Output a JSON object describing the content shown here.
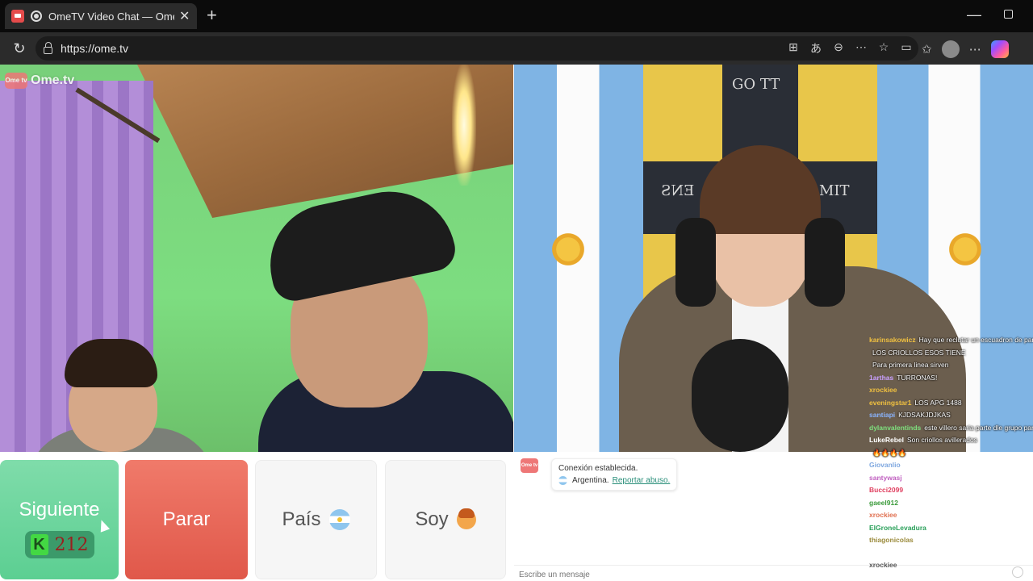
{
  "browser": {
    "tab_title": "OmeTV Video Chat — Omegle",
    "tab_close": "✕",
    "new_tab": "+",
    "url": "https://ome.tv"
  },
  "left_video": {
    "watermark": "Ome.tv",
    "badge": "Ome tv"
  },
  "right_video": {
    "banner_top": "GO TT",
    "banner_left": "ENS",
    "banner_right": "MIT"
  },
  "stream_chat": [
    {
      "user": "karinsakowicz",
      "color": "#f0c040",
      "msg": "Hay que reclutar un escuadron de par"
    },
    {
      "user": "",
      "color": "#8ab4ff",
      "msg": "LOS CRIOLLOS ESOS TIENE"
    },
    {
      "user": "",
      "color": "#6ad2ff",
      "msg": "Para primera linea sirven"
    },
    {
      "user": "1arthas",
      "color": "#c9a0ff",
      "msg": "TURRONAS!"
    },
    {
      "user": "xrockiee",
      "color": "#f0c040",
      "msg": ""
    },
    {
      "user": "eveningstar1",
      "color": "#f0c040",
      "msg": "LOS APG 1488"
    },
    {
      "user": "santiapi",
      "color": "#8ab4ff",
      "msg": "KJDSAKJDJKAS"
    },
    {
      "user": "dylanvalentinds",
      "color": "#7ee07e",
      "msg": "este villero saria parte dle grupo par"
    },
    {
      "user": "LukeRebel",
      "color": "#ffffff",
      "msg": "Son criollos avillerados"
    },
    {
      "user": "",
      "color": "#7ee07e",
      "msg": "🔥🔥🔥🔥"
    },
    {
      "user": "Giovanlio",
      "color": "#7fa8e0",
      "msg": "",
      "faded": true
    },
    {
      "user": "santywasj",
      "color": "#c060c0",
      "msg": "",
      "faded": true
    },
    {
      "user": "Bucci2099",
      "color": "#e04060",
      "msg": "",
      "faded": true
    },
    {
      "user": "gaeel912",
      "color": "#3a9a3a",
      "msg": "",
      "faded": true
    },
    {
      "user": "xrockiee",
      "color": "#e07050",
      "msg": "",
      "faded": true
    },
    {
      "user": "ElGroneLevadura",
      "color": "#2aa05a",
      "msg": "",
      "faded": true
    },
    {
      "user": "thiagonicolas",
      "color": "#9a8a3a",
      "msg": "",
      "faded": true
    },
    {
      "user": "",
      "color": "#555555",
      "msg": "",
      "faded": true
    },
    {
      "user": "xrockiee",
      "color": "#555555",
      "msg": "",
      "faded": true
    }
  ],
  "controls": {
    "next_label": "Siguiente",
    "karma_letter": "K",
    "karma_count": "212",
    "stop_label": "Parar",
    "country_label": "País",
    "soy_label": "Soy"
  },
  "chat": {
    "badge": "Ome tv",
    "connection": "Conexión establecida.",
    "country": "Argentina.",
    "report": "Reportar abuso.",
    "input_placeholder": "Escribe un mensaje"
  },
  "colors": {
    "next_button": "#5ccf92",
    "stop_button": "#e0584a",
    "report_link": "#2a8f7a"
  }
}
